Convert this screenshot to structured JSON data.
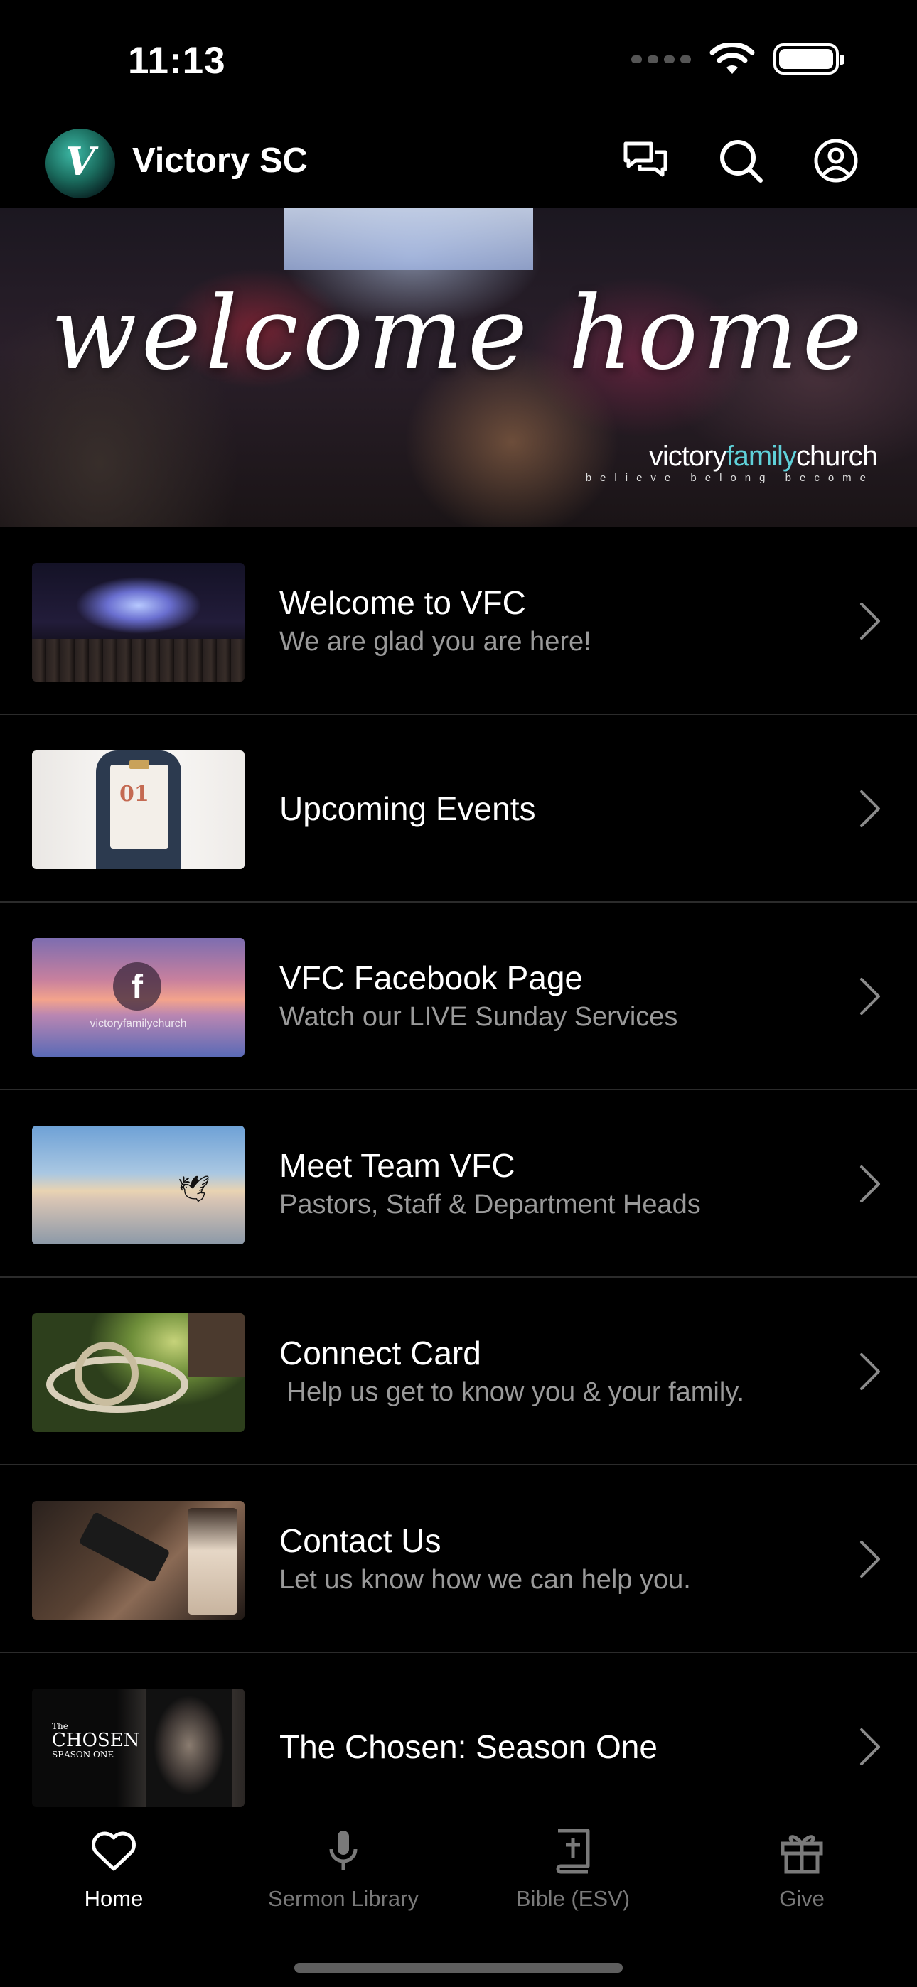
{
  "status_bar": {
    "time": "11:13"
  },
  "header": {
    "app_title": "Victory SC"
  },
  "hero": {
    "welcome_text": "welcome home",
    "brand_pre": "victory",
    "brand_accent": "family",
    "brand_post": "church",
    "tagline": "believe   belong   become"
  },
  "list": {
    "items": [
      {
        "title": "Welcome to VFC",
        "subtitle": "We are glad you are here!"
      },
      {
        "title": "Upcoming Events",
        "subtitle": ""
      },
      {
        "title": "VFC Facebook Page",
        "subtitle": "Watch our LIVE Sunday Services"
      },
      {
        "title": "Meet Team VFC",
        "subtitle": "Pastors, Staff & Department Heads"
      },
      {
        "title": "Connect Card",
        "subtitle": " Help us get to know you & your family."
      },
      {
        "title": "Contact Us",
        "subtitle": "Let us know how we can help you."
      },
      {
        "title": "The Chosen: Season One",
        "subtitle": ""
      }
    ],
    "thumb_text": {
      "events_number": "01",
      "facebook_letter": "f",
      "facebook_caption": "victoryfamilychurch",
      "chosen_the": "The",
      "chosen_title": "CHOSEN",
      "chosen_season": "SEASON ONE"
    }
  },
  "tabbar": {
    "tabs": [
      {
        "label": "Home",
        "icon": "heart-icon",
        "active": true
      },
      {
        "label": "Sermon Library",
        "icon": "microphone-icon",
        "active": false
      },
      {
        "label": "Bible (ESV)",
        "icon": "bible-icon",
        "active": false
      },
      {
        "label": "Give",
        "icon": "gift-icon",
        "active": false
      }
    ]
  },
  "colors": {
    "background": "#000000",
    "accent": "#5fd1d9",
    "muted_text": "#9a9a9a",
    "inactive_tab": "#7a7a7a"
  }
}
